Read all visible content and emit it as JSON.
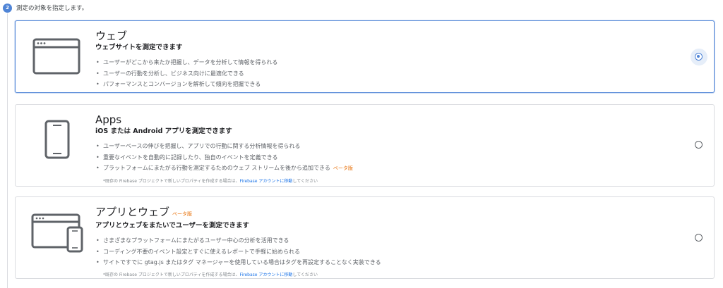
{
  "step": {
    "number": "2",
    "title": "測定の対象を指定します。"
  },
  "options": [
    {
      "title": "ウェブ",
      "subtitle": "ウェブサイトを測定できます",
      "bullets": [
        "ユーザーがどこから来たか把握し、データを分析して情報を得られる",
        "ユーザーの行動を分析し、ビジネス向けに最適化できる",
        "パフォーマンスとコンバージョンを解析して傾向を把握できる"
      ],
      "selected": true
    },
    {
      "title": "Apps",
      "subtitle": "iOS または Android アプリを測定できます",
      "bullets": [
        "ユーザーベースの伸びを把握し、アプリでの行動に関する分析情報を得られる",
        "重要なイベントを自動的に記録したり、独自のイベントを定義できる",
        "プラットフォームにまたがる行動を測定するためのウェブ ストリームを後から追加できる"
      ],
      "bullet_beta": "ベータ版",
      "note_text": "*既存の Firebase プロジェクトで新しいプロパティを作成する場合は、",
      "note_link": "Firebase アカウントに移動",
      "note_end": "してください",
      "selected": false
    },
    {
      "title": "アプリとウェブ",
      "title_beta": "ベータ版",
      "subtitle": "アプリとウェブをまたいでユーザーを測定できます",
      "bullets": [
        "さまざまなプラットフォームにまたがるユーザー中心の分析を活用できる",
        "コーディング不要のイベント設定とすぐに使えるレポートで手軽に始められる",
        "サイトですでに gtag.js またはタグ マネージャーを使用している場合はタグを再設定することなく実装できる"
      ],
      "note_text": "*既存の Firebase プロジェクトで新しいプロパティを作成する場合は、",
      "note_link": "Firebase アカウントに移動",
      "note_end": "してください",
      "selected": false
    }
  ],
  "colors": {
    "accent": "#4f84d6",
    "beta": "#e8710a",
    "link": "#1a73e8",
    "icon": "#5f6368"
  }
}
